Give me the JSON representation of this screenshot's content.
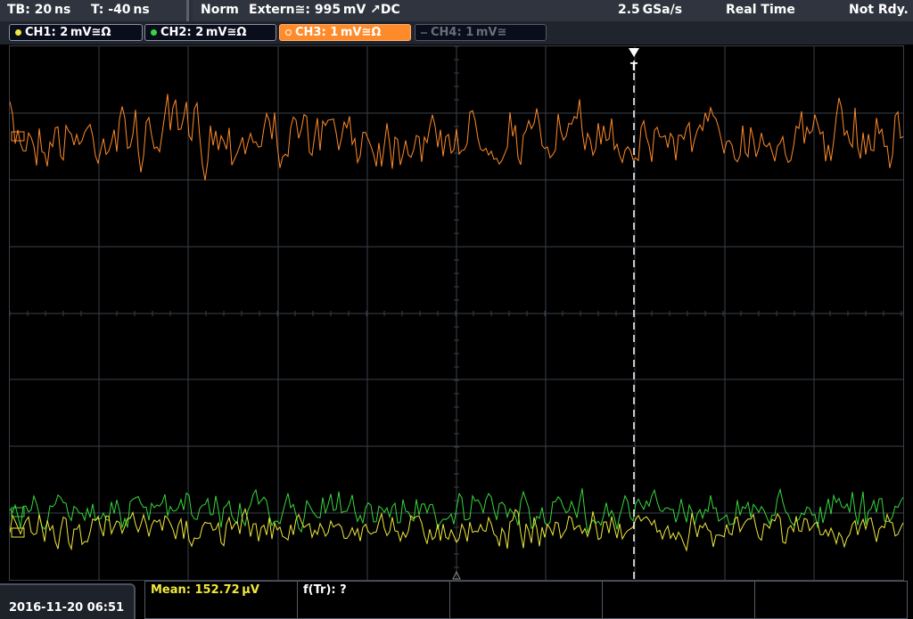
{
  "top_bar": {
    "timebase": "TB: 20 ns",
    "trigger_offset": "T: -40 ns",
    "trigger_mode": "Norm",
    "trigger_source": "Extern≅: 995 mV ↗DC",
    "sample_rate": "2.5 GSa/s",
    "acq_mode": "Real Time",
    "status": "Not Rdy."
  },
  "channels": [
    {
      "label": "CH1: 2 mV≅Ω",
      "color": "#f0e83c",
      "active": true
    },
    {
      "label": "CH2: 2 mV≅Ω",
      "color": "#36d83c",
      "active": true
    },
    {
      "label": "CH3: 1 mV≅Ω",
      "color": "#ff8a2a",
      "active": true,
      "selected": true
    },
    {
      "label": "CH4: 1 mV≅",
      "color": "#6a6e78",
      "active": false
    }
  ],
  "trigger_marker": "T",
  "waveforms": [
    {
      "channel": "CH3",
      "color": "#ff8a2a"
    },
    {
      "channel": "CH2",
      "color": "#36d83c"
    },
    {
      "channel": "CH1",
      "color": "#f0e83c"
    }
  ],
  "bottom": {
    "datetime": "2016-11-20 06:51",
    "measurements": [
      "Mean: 152.72 µV",
      "f(Tr): ?",
      "",
      "",
      ""
    ]
  },
  "colors": {
    "grid": "#3a3f48",
    "trigger_line": "#ffffff",
    "meas_yellow": "#f0e83c"
  }
}
